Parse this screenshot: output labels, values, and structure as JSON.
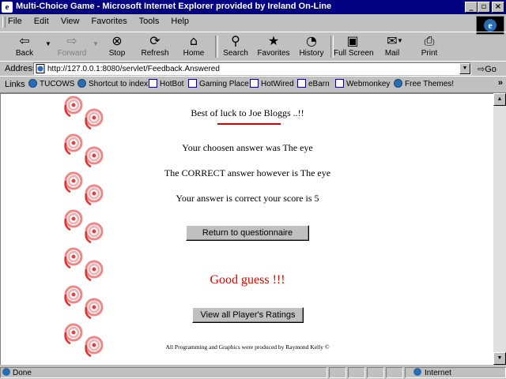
{
  "window": {
    "title": "Multi-Choice Game - Microsoft Internet Explorer provided by Ireland On-Line",
    "controls": {
      "minimize": "_",
      "maximize": "▫",
      "close": "×"
    }
  },
  "menu": [
    "File",
    "Edit",
    "View",
    "Favorites",
    "Tools",
    "Help"
  ],
  "toolbar": {
    "back": "Back",
    "forward": "Forward",
    "stop": "Stop",
    "refresh": "Refresh",
    "home": "Home",
    "search": "Search",
    "favorites": "Favorites",
    "history": "History",
    "fullscreen": "Full Screen",
    "mail": "Mail",
    "print": "Print"
  },
  "address": {
    "label": "Address",
    "url": "http://127.0.0.1:8080/servlet/Feedback.Answered",
    "go": "Go"
  },
  "links": {
    "label": "Links",
    "items": [
      "TUCOWS",
      "Shortcut to index",
      "HotBot",
      "Gaming Place",
      "HotWired",
      "eBarn",
      "Webmonkey",
      "Free Themes!"
    ],
    "more": "»"
  },
  "page": {
    "greeting": "Best of luck to Joe Bloggs ..!!",
    "chosen": "Your choosen answer was The eye",
    "correct": "The CORRECT answer however is The eye",
    "result": "Your answer is correct your score is 5",
    "return_button": "Return to questionnaire",
    "good_guess": "Good guess !!!",
    "ratings_button": "View all Player's Ratings",
    "credit": "All Programming and Graphics were produced by Raymond Kelly ©"
  },
  "status": {
    "text": "Done",
    "zone": "Internet"
  },
  "colors": {
    "titlebar": "#000080",
    "accent_red": "#cc0000",
    "good_guess": "#e00000"
  }
}
